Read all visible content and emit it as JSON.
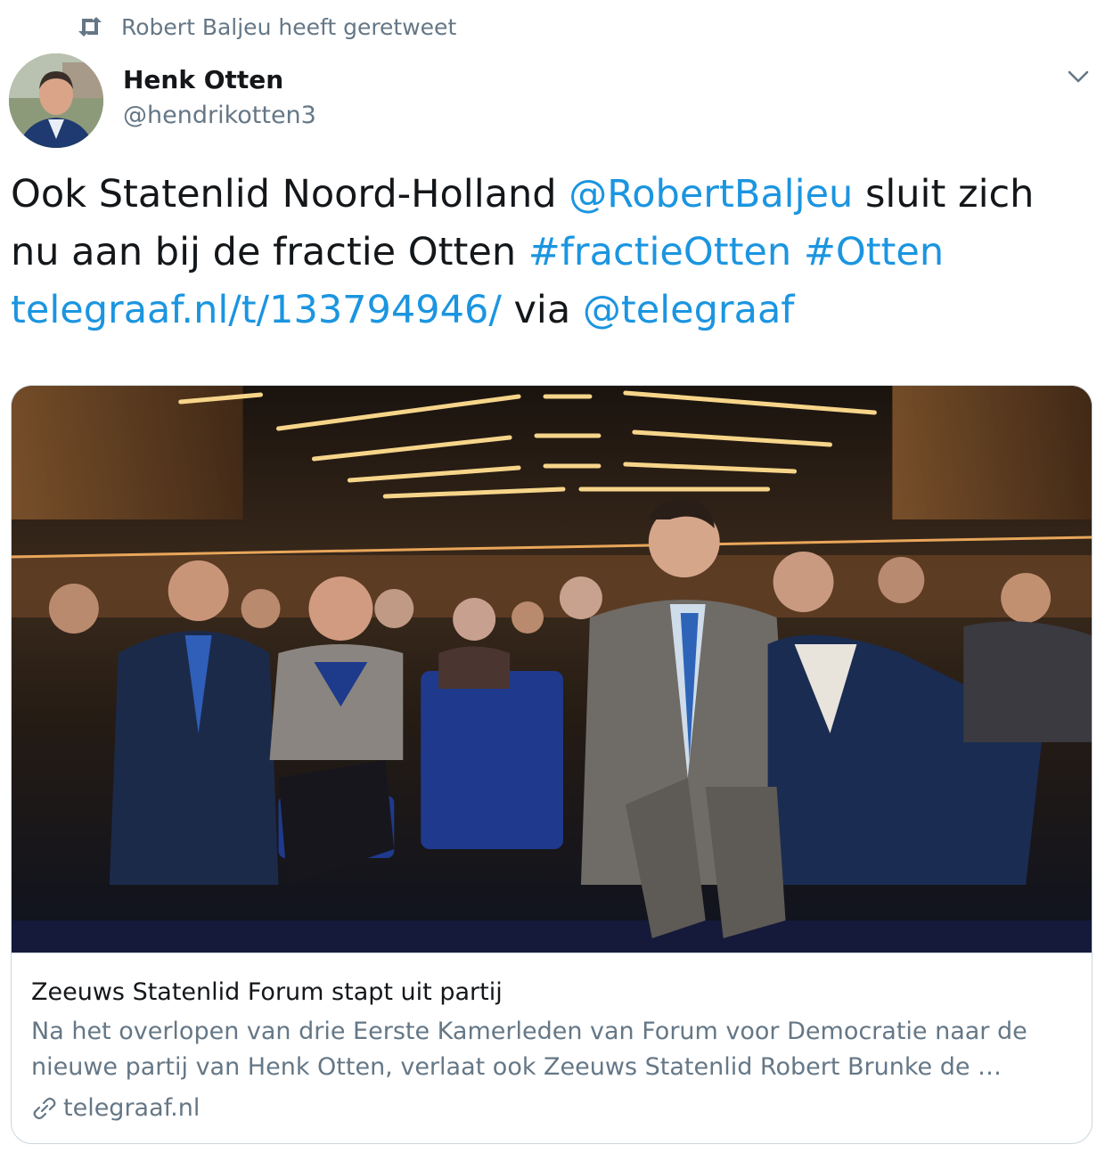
{
  "retweet": {
    "icon": "retweet-icon",
    "text": "Robert Baljeu heeft geretweet"
  },
  "author": {
    "name": "Henk Otten",
    "handle": "@hendrikotten3",
    "avatar": "avatar-photo"
  },
  "menu_icon": "chevron-down-icon",
  "tweet": {
    "part1": "Ook Statenlid Noord-Holland ",
    "mention1": "@RobertBaljeu",
    "part2": " sluit zich nu aan bij de fractie Otten ",
    "hashtag1": "#fractieOtten",
    "space": " ",
    "hashtag2": "#Otten",
    "url": "telegraaf.nl/t/133794946/",
    "via": " via ",
    "mention2": "@telegraaf"
  },
  "card": {
    "title": "Zeeuws Statenlid Forum stapt uit partij",
    "description": "Na het overlopen van drie Eerste Kamerleden van Forum voor Democratie naar de nieuwe partij van Henk Otten, verlaat ook Zeeuws Statenlid Robert Brunke de …",
    "domain": "telegraaf.nl",
    "domain_icon": "link-icon"
  },
  "colors": {
    "link": "#1b95e0",
    "secondary_text": "#657786",
    "border": "#ccd6dd"
  }
}
